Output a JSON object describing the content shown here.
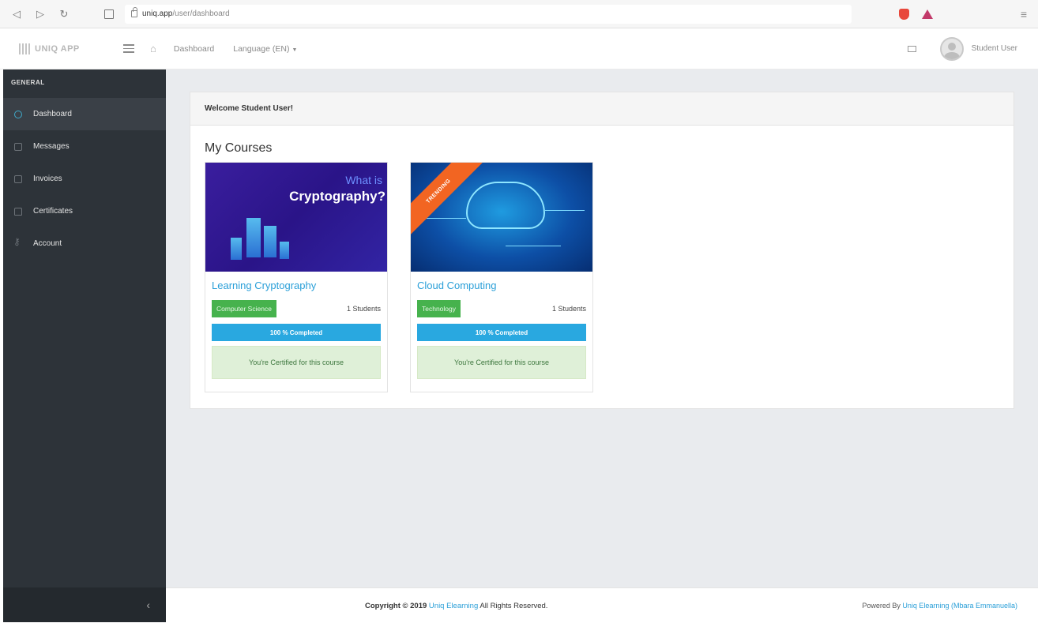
{
  "browser": {
    "url_host": "uniq.app",
    "url_path": "/user/dashboard"
  },
  "header": {
    "logo_text": "UNIQ APP",
    "nav_dashboard": "Dashboard",
    "nav_language": "Language (EN)",
    "user_name": "Student User"
  },
  "sidebar": {
    "heading": "GENERAL",
    "items": [
      {
        "label": "Dashboard",
        "icon": "dashboard-icon",
        "active": true
      },
      {
        "label": "Messages",
        "icon": "messages-icon",
        "active": false
      },
      {
        "label": "Invoices",
        "icon": "invoices-icon",
        "active": false
      },
      {
        "label": "Certificates",
        "icon": "certificates-icon",
        "active": false
      },
      {
        "label": "Account",
        "icon": "key-icon",
        "active": false
      }
    ]
  },
  "panel": {
    "welcome": "Welcome Student User!",
    "section_title": "My Courses"
  },
  "courses": [
    {
      "image_text_1": "What is",
      "image_text_2": "Cryptography?",
      "title": "Learning Cryptography",
      "category": "Computer Science",
      "students": "1 Students",
      "progress": 1.0,
      "progress_label": "100 % Completed",
      "certified": "You're Certified for this course"
    },
    {
      "ribbon": "TRENDING",
      "title": "Cloud Computing",
      "category": "Technology",
      "students": "1 Students",
      "progress": 1.0,
      "progress_label": "100 % Completed",
      "certified": "You're Certified for this course"
    }
  ],
  "footer": {
    "copyright_prefix": "Copyright © 2019",
    "copyright_link": "Uniq Elearning",
    "copyright_suffix": "All Rights Reserved.",
    "powered_prefix": "Powered By",
    "powered_link": "Uniq Elearning (Mbara Emmanuella)"
  },
  "colors": {
    "accent": "#2a9fd8",
    "sidebar_bg": "#2d3339",
    "badge_green": "#46b24d",
    "progress_blue": "#29a8e0",
    "ribbon_orange": "#f26522"
  }
}
